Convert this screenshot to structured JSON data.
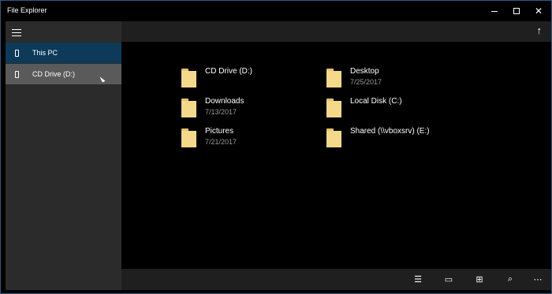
{
  "window": {
    "title": "File Explorer"
  },
  "sidebar": {
    "items": [
      {
        "label": "This PC",
        "icon": "device-icon",
        "selected": true
      },
      {
        "label": "CD Drive (D:)",
        "icon": "device-icon",
        "hover": true
      }
    ]
  },
  "items": [
    {
      "name": "CD Drive (D:)",
      "date": ""
    },
    {
      "name": "Desktop",
      "date": "7/25/2017"
    },
    {
      "name": "Downloads",
      "date": "7/13/2017"
    },
    {
      "name": "Local Disk (C:)",
      "date": ""
    },
    {
      "name": "Pictures",
      "date": "7/21/2017"
    },
    {
      "name": "Shared (\\\\vboxsrv) (E:)",
      "date": ""
    }
  ],
  "colors": {
    "accent_selected": "#0d3a59",
    "hover_item": "#5a5a5a",
    "folder": "#f5d98a"
  }
}
